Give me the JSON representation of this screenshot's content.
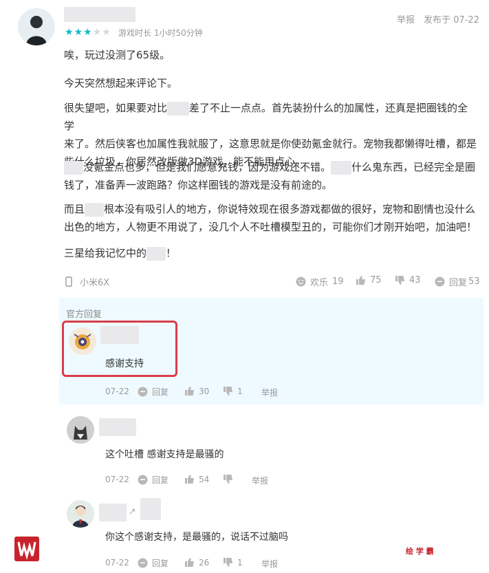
{
  "review": {
    "stars_filled": 3,
    "stars_total": 5,
    "playtime": "游戏时长 1小时50分钟",
    "report_label": "举报",
    "posted": "发布于 07-22",
    "paragraphs": [
      "唉，玩过没测了65级。",
      "今天突然想起来评论下。",
      "很失望吧，如果要对比",
      "差了不止一点点。首先装扮什么的加属性，还真是把圈钱的全学",
      "来了。然后侠客也加属性我就服了，这意思就是你使劲氪金就行。宠物我都懒得吐槽，都是",
      "些什么垃圾，你居然改版做3D游戏，能不能用点心。",
      "没氪金点也多，但是我们愿意充钱，因为游戏还不错。",
      "什么鬼东西，已经完全是圈",
      "钱了，准备弄一波跑路？你这样圈钱的游戏是没有前途的。",
      "而且",
      "根本没有吸引人的地方，你说特效现在很多游戏都做的很好，宠物和剧情也没什么",
      "出色的地方，人物更不用说了，没几个人不吐槽模型丑的，可能你们才刚开始吧，加油吧！",
      "三星给我记忆中的",
      "！"
    ],
    "device": "小米6X",
    "reactions": {
      "fun_label": "欢乐",
      "fun_count": "19",
      "up_count": "75",
      "down_count": "43",
      "reply_label": "回复",
      "reply_count": "53"
    }
  },
  "official": {
    "section_title": "官方回复",
    "text": "感谢支持",
    "date": "07-22",
    "reply_label": "回复",
    "up_count": "30",
    "down_count": "1",
    "report_label": "举报"
  },
  "replies": [
    {
      "text": "这个吐槽 感谢支持是最骚的",
      "date": "07-22",
      "reply_label": "回复",
      "up_count": "54",
      "down_count": "",
      "report_label": "举报"
    },
    {
      "text": "你这个感谢支持，是最骚的，说话不过脑吗",
      "date": "07-22",
      "reply_label": "回复",
      "up_count": "26",
      "down_count": "1",
      "report_label": "举报"
    }
  ],
  "watermark": {
    "text": "绘 学 霸"
  },
  "colors": {
    "star_on": "#14b9c8",
    "star_off": "#d8d8d8",
    "highlight": "#d93c4a",
    "official_bg": "#eefaff"
  }
}
